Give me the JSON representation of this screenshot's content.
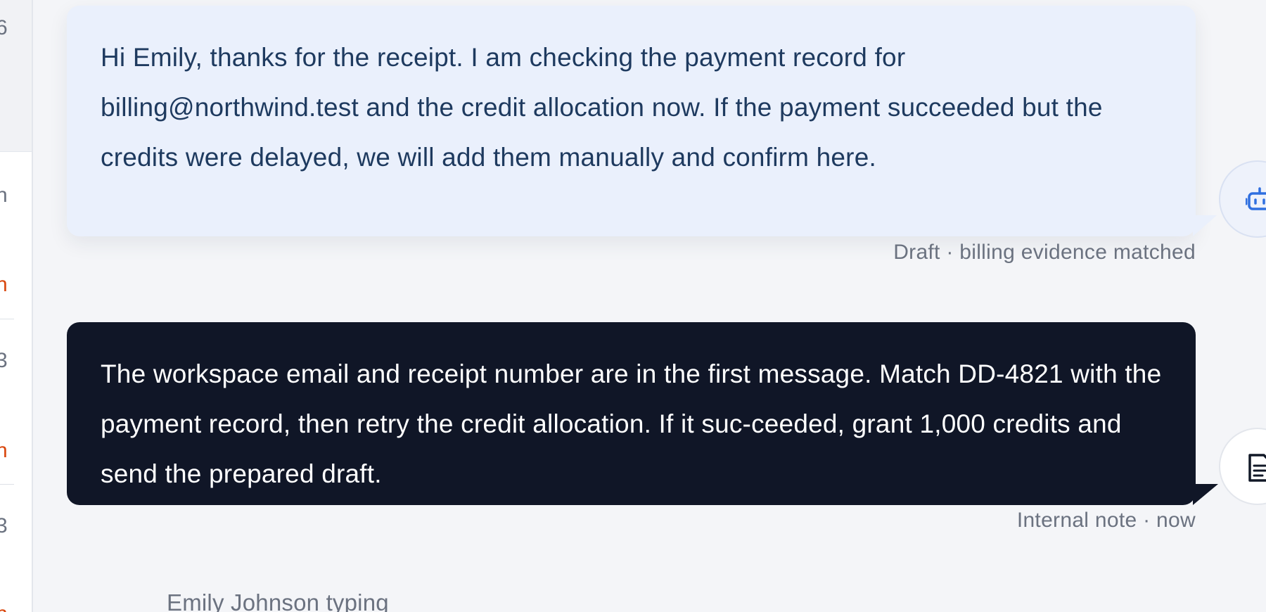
{
  "sidebar": {
    "fragments": [
      {
        "text": "6",
        "alert": false
      },
      {
        "text": "n",
        "alert": false
      },
      {
        "text": ".",
        "alert": false
      },
      {
        "text": "n",
        "alert": true
      },
      {
        "text": "3",
        "alert": false
      },
      {
        "text": "n",
        "alert": true
      },
      {
        "text": "3",
        "alert": false
      },
      {
        "text": "n",
        "alert": true
      }
    ]
  },
  "messages": {
    "draft": {
      "text": "Hi Emily, thanks for the receipt. I am checking the payment record for billing@northwind.test and the credit allocation now. If the payment succeeded but the credits were delayed, we will add them manually and confirm here.",
      "meta": "Draft · billing evidence matched",
      "avatar_icon": "robot-icon"
    },
    "note": {
      "text": "The workspace email and receipt number are in the first message. Match DD-4821 with the payment record, then retry the credit allocation. If it suc-ceeded, grant 1,000 credits and send the prepared draft.",
      "meta": "Internal note · now",
      "avatar_icon": "document-icon"
    }
  },
  "typing_indicator": "Emily Johnson  typing",
  "colors": {
    "draft_bg": "#eaf0fc",
    "draft_text": "#1e3a5f",
    "note_bg": "#101627",
    "alert": "#d9480f",
    "accent": "#2f6fe0"
  }
}
